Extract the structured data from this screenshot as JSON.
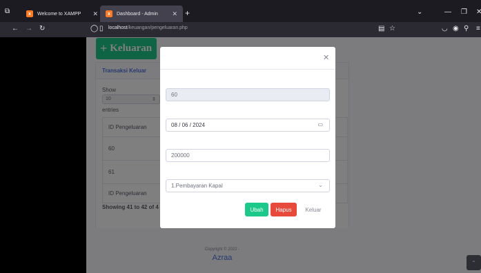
{
  "browser": {
    "tabs": [
      {
        "label": "Welcome to XAMPP",
        "favicon": "xampp"
      },
      {
        "label": "Dashboard - Admin",
        "favicon": "xampp"
      }
    ],
    "url_host": "localhost",
    "url_path": "/keuangan/pengeluaran.php"
  },
  "page": {
    "add_button_label": "Keluaran",
    "card_title": "Transaksi Keluar",
    "show_label": "Show",
    "entries_value": "10",
    "entries_label": "entries",
    "table": {
      "header": "ID Pengeluaran",
      "rows": [
        "60",
        "61"
      ],
      "footer": "ID Pengeluaran"
    },
    "showing_text": "Showing 41 to 42 of 4",
    "copyright": "Copyright © 2022 -",
    "brand": "Azraa"
  },
  "modal": {
    "id_value": "60",
    "date_value": "08 / 06 / 2024",
    "amount_value": "200000",
    "category_value": "1.Pembayaran Kapal",
    "buttons": {
      "ubah": "Ubah",
      "hapus": "Hapus",
      "keluar": "Keluar"
    }
  },
  "colors": {
    "success": "#1cc88a",
    "danger": "#e74a3b",
    "primary": "#4e73df"
  }
}
